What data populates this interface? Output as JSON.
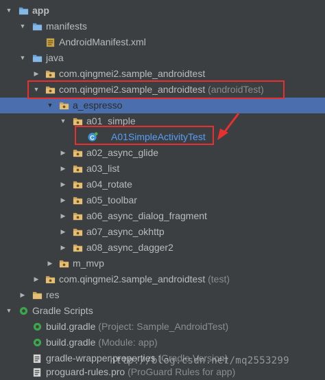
{
  "tree": {
    "app": "app",
    "manifests": "manifests",
    "android_manifest": "AndroidManifest.xml",
    "java": "java",
    "pkg_main": "com.qingmei2.sample_androidtest",
    "pkg_android_test": "com.qingmei2.sample_androidtest",
    "pkg_android_test_hint": "(androidTest)",
    "a_espresso": "a_espresso",
    "a01_simple": "a01_simple",
    "a01_test_class": "A01SimpleActivityTest",
    "a02": "a02_async_glide",
    "a03": "a03_list",
    "a04": "a04_rotate",
    "a05": "a05_toolbar",
    "a06": "a06_async_dialog_fragment",
    "a07": "a07_async_okhttp",
    "a08": "a08_async_dagger2",
    "m_mvp": "m_mvp",
    "pkg_test": "com.qingmei2.sample_androidtest",
    "pkg_test_hint": "(test)",
    "res": "res",
    "gradle_scripts": "Gradle Scripts",
    "build_gradle_project": "build.gradle",
    "build_gradle_project_hint": "(Project: Sample_AndroidTest)",
    "build_gradle_module": "build.gradle",
    "build_gradle_module_hint": "(Module: app)",
    "gradle_wrapper": "gradle-wrapper.properties",
    "gradle_wrapper_hint": "(Gradle Version)",
    "proguard": "proguard-rules.pro",
    "proguard_hint": "(ProGuard Rules for app)"
  },
  "watermark": "http://blog.csdn.net/mq2553299",
  "colors": {
    "background": "#3c3f41",
    "selection": "#4b6eaf",
    "text": "#bbbbbb",
    "hint": "#8c8c8c",
    "link": "#589df6",
    "annotation_red": "#e83030",
    "folder": "#c9a15b"
  },
  "icons": {
    "expanded": "triangle-down-icon",
    "collapsed": "triangle-right-icon",
    "folder": "folder-icon",
    "package": "package-icon",
    "class": "class-c-icon",
    "manifest": "manifest-file-icon",
    "gradle": "gradle-icon",
    "properties": "properties-file-icon"
  }
}
